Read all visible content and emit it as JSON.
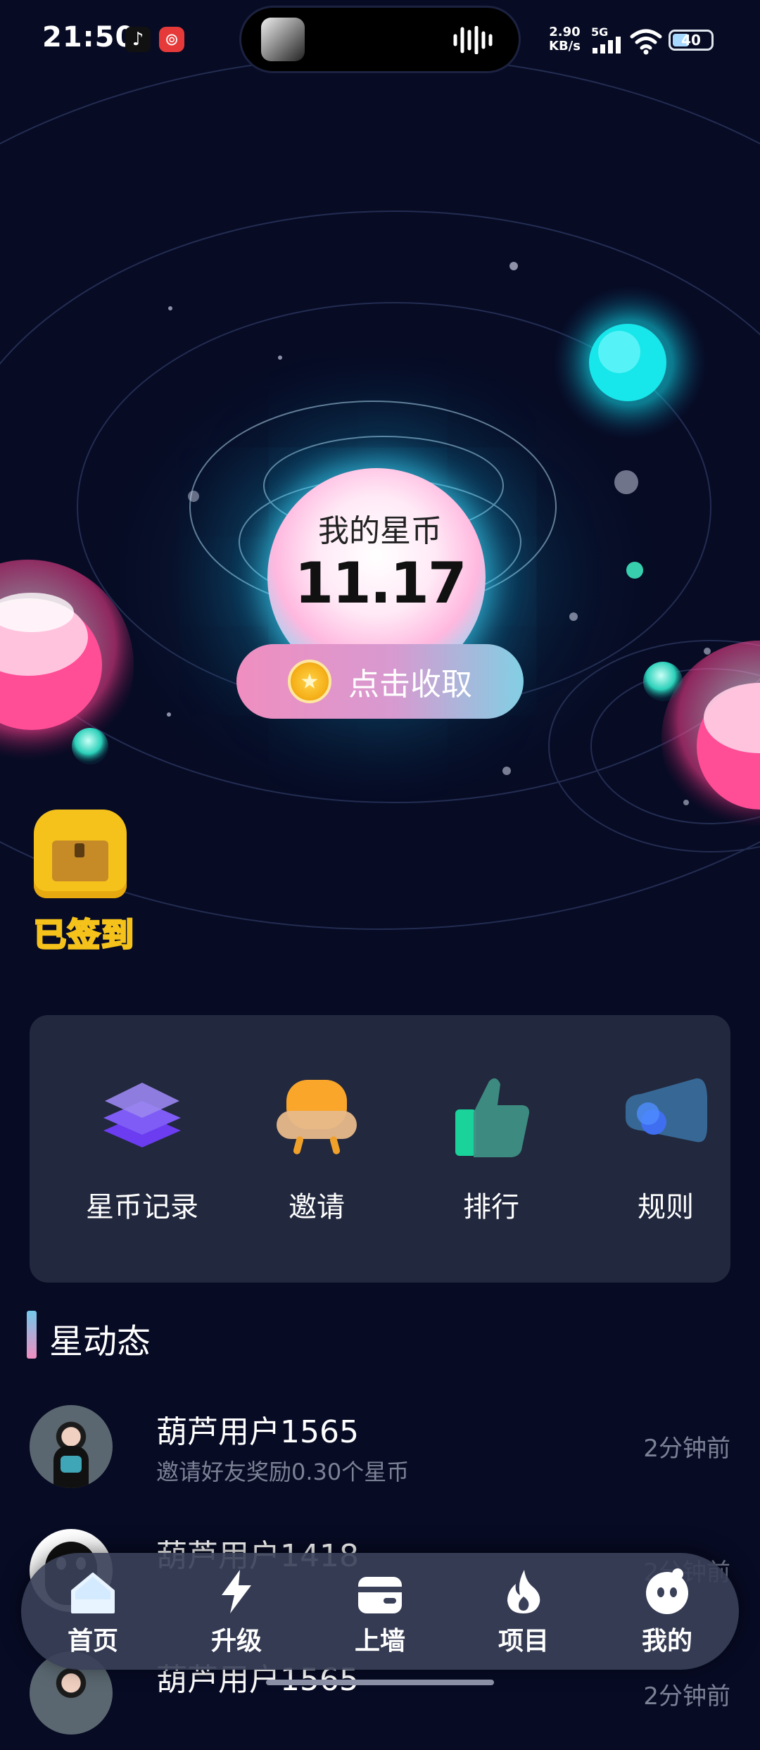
{
  "status_bar": {
    "time": "21:50",
    "net_speed_value": "2.90",
    "net_speed_unit": "KB/s",
    "signal_label": "5G",
    "battery_level": "40",
    "icons": [
      "douyin-icon",
      "netease-music-icon",
      "soundwave-icon",
      "signal-icon",
      "wifi-icon",
      "battery-icon"
    ]
  },
  "hero": {
    "coins_label": "我的星币",
    "coins_value": "11.17",
    "collect_label": "点击收取"
  },
  "checkin": {
    "label": "已签到"
  },
  "menu": [
    {
      "label": "星币记录",
      "icon": "layers-icon"
    },
    {
      "label": "邀请",
      "icon": "armchair-icon"
    },
    {
      "label": "排行",
      "icon": "thumbs-up-icon"
    },
    {
      "label": "规则",
      "icon": "megaphone-icon"
    }
  ],
  "feed": {
    "title": "星动态",
    "items": [
      {
        "name": "葫芦用户1565",
        "desc": "邀请好友奖励0.30个星币",
        "time": "2分钟前"
      },
      {
        "name": "葫芦用户1418",
        "desc": "",
        "time": "2分钟前"
      },
      {
        "name": "葫芦用户1565",
        "desc": "",
        "time": "2分钟前"
      }
    ]
  },
  "nav": [
    {
      "label": "首页",
      "icon": "home-icon"
    },
    {
      "label": "升级",
      "icon": "lightning-icon"
    },
    {
      "label": "上墙",
      "icon": "wallet-icon"
    },
    {
      "label": "项目",
      "icon": "flame-icon"
    },
    {
      "label": "我的",
      "icon": "profile-icon"
    }
  ],
  "colors": {
    "background": "#070b24",
    "accent_pink": "#f08ec0",
    "accent_cyan": "#74c8ec",
    "card": "#22283d",
    "gold": "#f5c21b"
  }
}
